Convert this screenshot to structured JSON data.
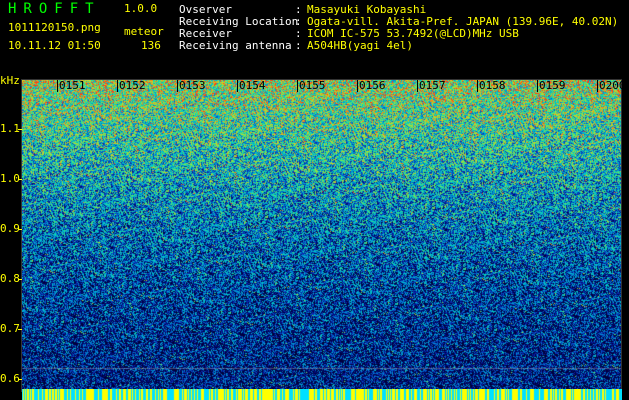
{
  "app": {
    "title": "HROFFT",
    "version": "1.0.0"
  },
  "file": {
    "name": "1011120150.png",
    "type": "meteor",
    "timestamp": "10.11.12 01:50",
    "count": "136"
  },
  "info": [
    {
      "label": "Ovserver",
      "sep": ":",
      "value": "Masayuki Kobayashi"
    },
    {
      "label": "Receiving Location",
      "sep": ":",
      "value": "Ogata-vill. Akita-Pref. JAPAN (139.96E, 40.02N)"
    },
    {
      "label": "Receiver",
      "sep": ":",
      "value": "ICOM IC-575 53.7492(@LCD)MHz USB"
    },
    {
      "label": "Receiving antenna",
      "sep": ":",
      "value": "A504HB(yagi 4el)"
    }
  ],
  "axis": {
    "unit": "kHz",
    "y_ticks": [
      "1.1",
      "1.0",
      "0.9",
      "0.8",
      "0.7",
      "0.6"
    ],
    "x_ticks": [
      "0151",
      "0152",
      "0153",
      "0154",
      "0155",
      "0156",
      "0157",
      "0158",
      "0159",
      "0200"
    ]
  },
  "colors": {
    "background": "#000000",
    "label": "#ffff00",
    "title": "#00ff00",
    "spectrum_low": "#0a1a8c",
    "spectrum_high": "#ff3300",
    "bottom_bar": "#ffff00"
  }
}
